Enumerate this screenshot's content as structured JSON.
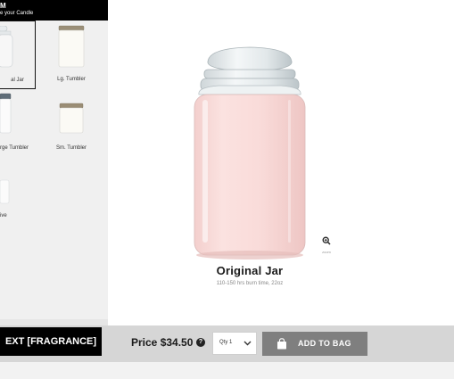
{
  "sidebar": {
    "title": "M",
    "subtitle": "e your Candle",
    "options": [
      {
        "label": "al Jar",
        "selected": true
      },
      {
        "label": "Lg. Tumbler",
        "selected": false
      },
      {
        "label": "rge Tumbler",
        "selected": false
      },
      {
        "label": "Sm. Tumbler",
        "selected": false
      },
      {
        "label": "ive",
        "selected": false
      }
    ]
  },
  "product": {
    "name": "Original Jar",
    "details": "110-150 hrs burn time, 22oz",
    "zoom_label": "zoom"
  },
  "bottom_bar": {
    "next_label": "EXT [FRAGRANCE]",
    "price": "Price $34.50",
    "help_icon": "?",
    "qty_selected": "Qty 1",
    "add_label": "ADD TO BAG"
  },
  "colors": {
    "candle_wax": "#f9d9d7",
    "glass": "#e3e8ea",
    "add_button": "#7f7f7f",
    "bottom_bar": "#d6d6d6",
    "sidebar_bg": "#f0f0f0"
  }
}
